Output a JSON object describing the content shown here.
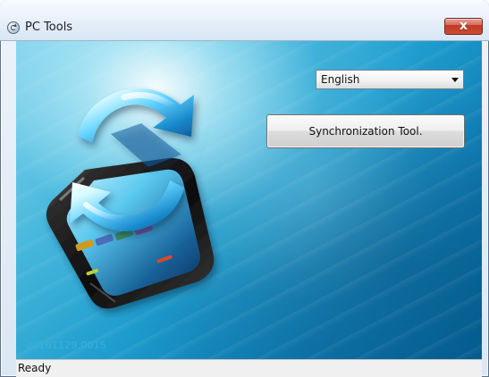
{
  "window": {
    "title": "PC Tools",
    "close_glyph": "x"
  },
  "controls": {
    "language_selected": "English",
    "sync_button_label": "Synchronization Tool."
  },
  "footer": {
    "version": "20101129.0015",
    "status": "Ready"
  },
  "icons": {
    "app_icon": "app-refresh-icon",
    "close_icon": "close-icon",
    "dropdown_icon": "chevron-down-icon",
    "device_icon": "phone-sync-icon"
  },
  "colors": {
    "title_text": "#1b1b1b",
    "close_button": "#cb4a34",
    "version_text": "#34b3dd",
    "status_bar": "#f0f0f0"
  }
}
